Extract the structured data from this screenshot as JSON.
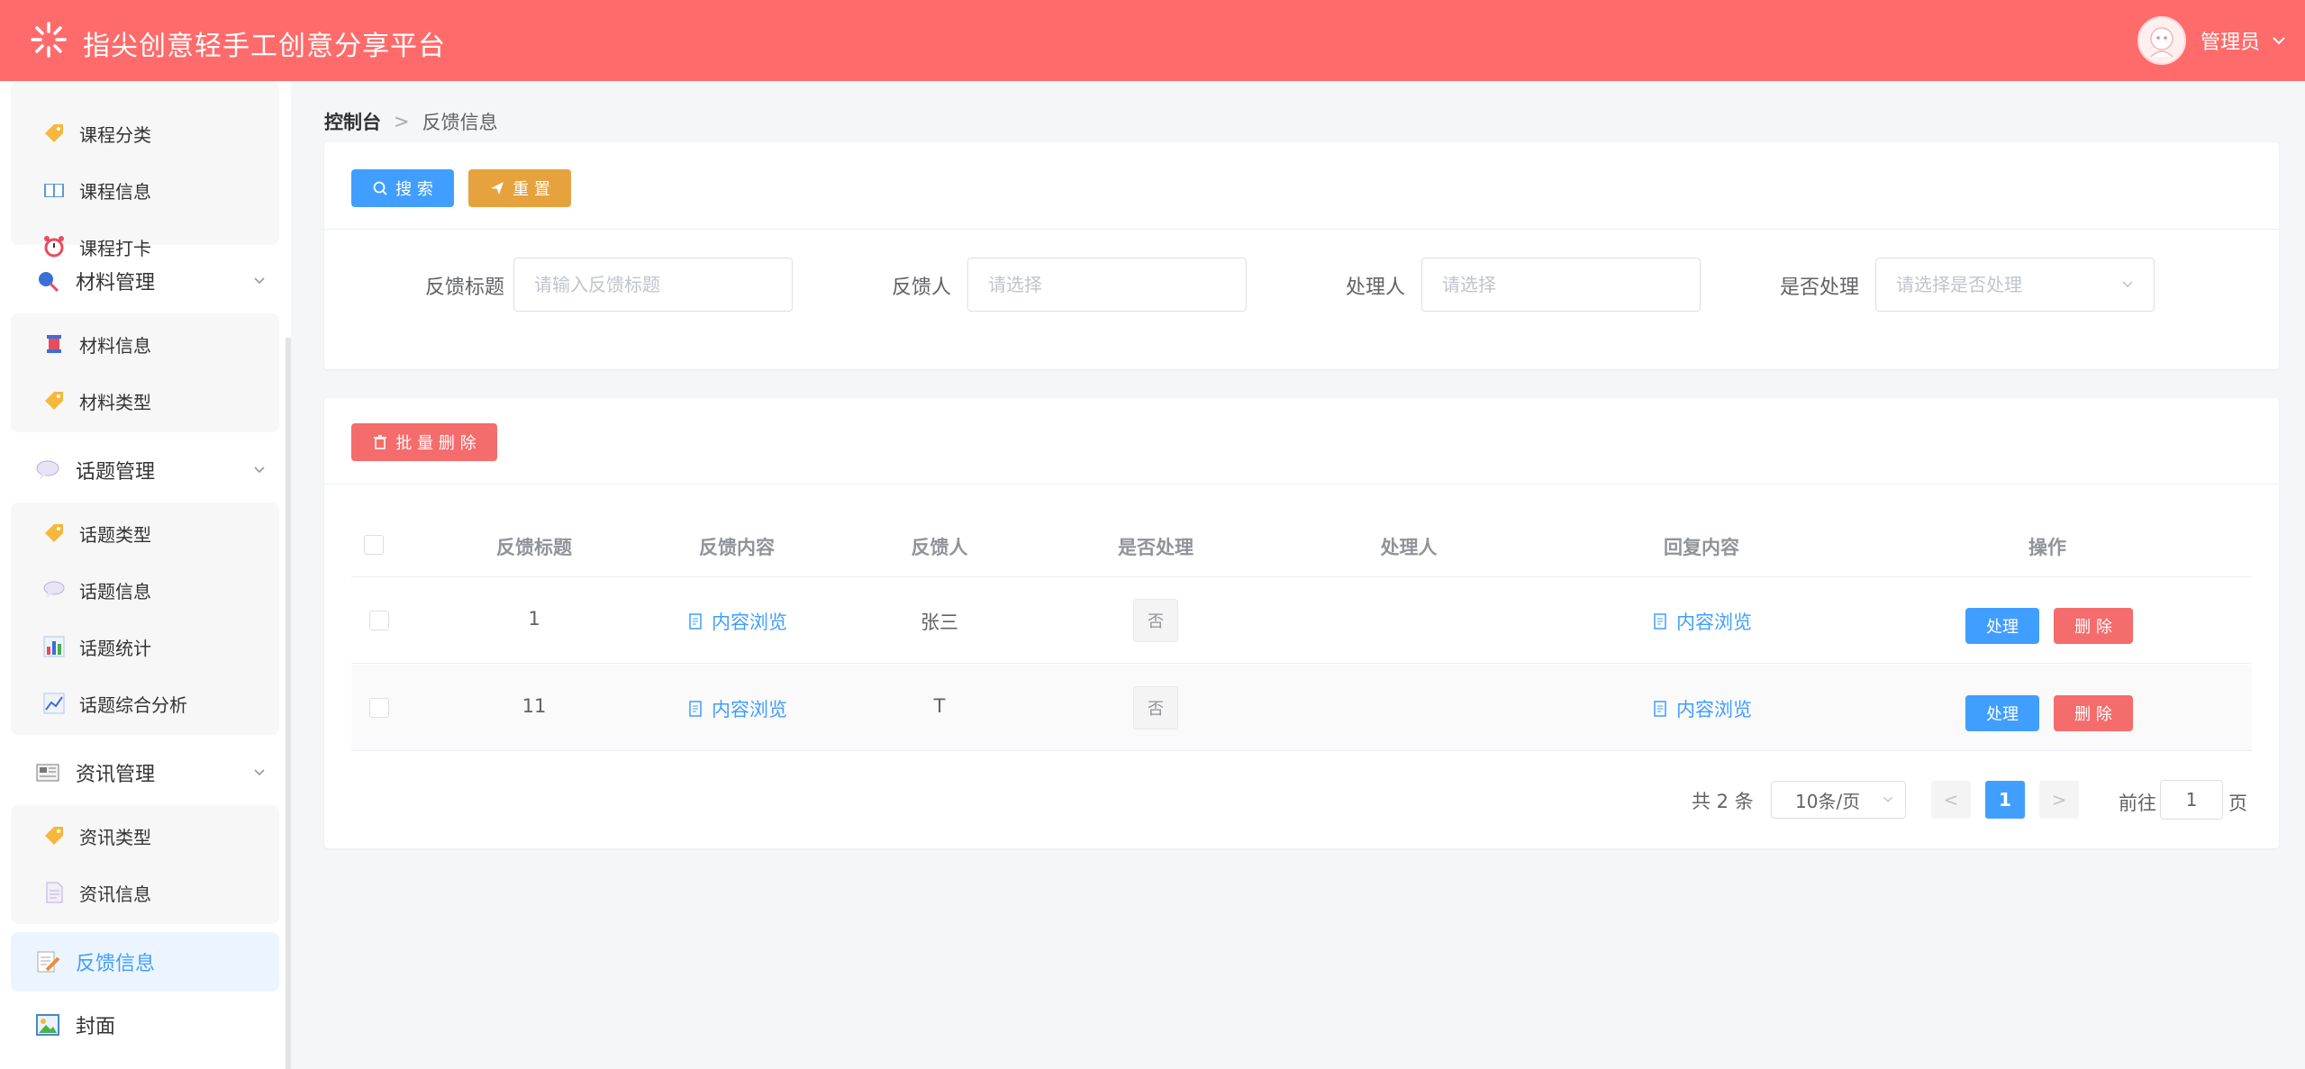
{
  "app": {
    "title": "指尖创意轻手工创意分享平台",
    "user_name": "管理员"
  },
  "sidebar": {
    "groups": [
      {
        "items": [
          {
            "label": "课程分类",
            "icon": "tag-icon"
          },
          {
            "label": "课程信息",
            "icon": "book-icon"
          },
          {
            "label": "课程打卡",
            "icon": "alarm-clock-icon"
          }
        ]
      },
      {
        "label": "材料管理",
        "icon": "pin-icon",
        "items": [
          {
            "label": "材料信息",
            "icon": "spool-icon"
          },
          {
            "label": "材料类型",
            "icon": "tag-icon"
          }
        ]
      },
      {
        "label": "话题管理",
        "icon": "speech-bubble-icon",
        "items": [
          {
            "label": "话题类型",
            "icon": "tag-icon"
          },
          {
            "label": "话题信息",
            "icon": "speech-bubble-icon"
          },
          {
            "label": "话题统计",
            "icon": "bar-chart-icon"
          },
          {
            "label": "话题综合分析",
            "icon": "line-chart-icon"
          }
        ]
      },
      {
        "label": "资讯管理",
        "icon": "newspaper-icon",
        "items": [
          {
            "label": "资讯类型",
            "icon": "tag-icon"
          },
          {
            "label": "资讯信息",
            "icon": "document-icon"
          }
        ]
      }
    ],
    "feedback": "反馈信息",
    "cover": "封面"
  },
  "breadcrumb": {
    "home": "控制台",
    "separator": ">",
    "current": "反馈信息"
  },
  "search": {
    "search_btn": "搜 索",
    "reset_btn": "重 置",
    "fields": [
      {
        "label": "反馈标题",
        "placeholder": "请输入反馈标题"
      },
      {
        "label": "反馈人",
        "placeholder": "请选择"
      },
      {
        "label": "处理人",
        "placeholder": "请选择"
      },
      {
        "label": "是否处理",
        "placeholder": "请选择是否处理"
      }
    ]
  },
  "table": {
    "batch_delete": "批 量 删 除",
    "columns": [
      "反馈标题",
      "反馈内容",
      "反馈人",
      "是否处理",
      "处理人",
      "回复内容",
      "操作"
    ],
    "rows": [
      {
        "title": "1",
        "content_link": "内容浏览",
        "submitter": "张三",
        "handled": "否",
        "handler": "",
        "reply_link": "内容浏览",
        "process_btn": "处理",
        "delete_btn": "删 除"
      },
      {
        "title": "11",
        "content_link": "内容浏览",
        "submitter": "T",
        "handled": "否",
        "handler": "",
        "reply_link": "内容浏览",
        "process_btn": "处理",
        "delete_btn": "删 除"
      }
    ]
  },
  "pagination": {
    "total": "共 2 条",
    "page_size": "10条/页",
    "prev": "<",
    "current_page": "1",
    "next": ">",
    "jump_label": "前往",
    "jump_value": "1",
    "page_unit": "页"
  },
  "colors": {
    "header": "#ff6b6b",
    "primary": "#409eff",
    "warning": "#e6a23c",
    "danger": "#f56c6c"
  }
}
